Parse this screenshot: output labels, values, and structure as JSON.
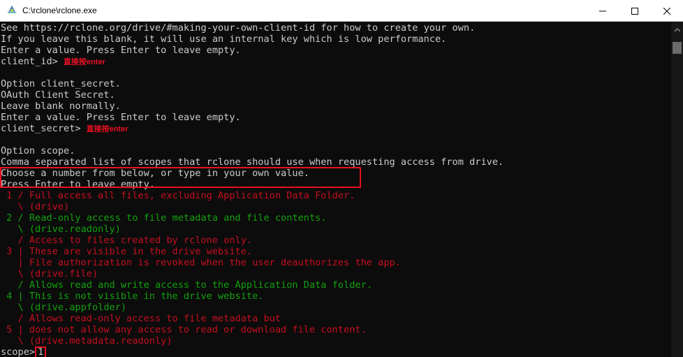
{
  "window": {
    "title": "C:\\rclone\\rclone.exe",
    "icons": {
      "app": "rclone-app-icon",
      "minimize": "minimize-icon",
      "maximize": "maximize-icon",
      "close": "close-icon"
    }
  },
  "console": {
    "lines": [
      {
        "text": "See https://rclone.org/drive/#making-your-own-client-id for how to create your own.",
        "color": "default"
      },
      {
        "text": "If you leave this blank, it will use an internal key which is low performance.",
        "color": "default"
      },
      {
        "text": "Enter a value. Press Enter to leave empty.",
        "color": "default"
      },
      {
        "text": "client_id>",
        "color": "default",
        "note": "直接按enter"
      },
      {
        "text": "",
        "color": "default"
      },
      {
        "text": "Option client_secret.",
        "color": "default"
      },
      {
        "text": "OAuth Client Secret.",
        "color": "default"
      },
      {
        "text": "Leave blank normally.",
        "color": "default"
      },
      {
        "text": "Enter a value. Press Enter to leave empty.",
        "color": "default"
      },
      {
        "text": "client_secret>",
        "color": "default",
        "note": "直接按enter"
      },
      {
        "text": "",
        "color": "default"
      },
      {
        "text": "Option scope.",
        "color": "default"
      },
      {
        "text": "Comma separated list of scopes that rclone should use when requesting access from drive.",
        "color": "default"
      },
      {
        "text": "Choose a number from below, or type in your own value.",
        "color": "default"
      },
      {
        "text": "Press Enter to leave empty.",
        "color": "default"
      },
      {
        "text": " 1 / Full access all files, excluding Application Data Folder.",
        "color": "red"
      },
      {
        "text": "   \\ (drive)",
        "color": "red"
      },
      {
        "text": " 2 / Read-only access to file metadata and file contents.",
        "color": "green"
      },
      {
        "text": "   \\ (drive.readonly)",
        "color": "green"
      },
      {
        "text": "   / Access to files created by rclone only.",
        "color": "red"
      },
      {
        "text": " 3 | These are visible in the drive website.",
        "color": "red"
      },
      {
        "text": "   | File authorization is revoked when the user deauthorizes the app.",
        "color": "red"
      },
      {
        "text": "   \\ (drive.file)",
        "color": "red"
      },
      {
        "text": "   / Allows read and write access to the Application Data folder.",
        "color": "green"
      },
      {
        "text": " 4 | This is not visible in the drive website.",
        "color": "green"
      },
      {
        "text": "   \\ (drive.appfolder)",
        "color": "green"
      },
      {
        "text": "   / Allows read-only access to file metadata but",
        "color": "red"
      },
      {
        "text": " 5 | does not allow any access to read or download file content.",
        "color": "red"
      },
      {
        "text": "   \\ (drive.metadata.readonly)",
        "color": "red"
      }
    ],
    "prompt": {
      "label": "scope>",
      "value": "1"
    }
  },
  "colors": {
    "background": "#0c0c0c",
    "default_text": "#cccccc",
    "green": "#13a10e",
    "red": "#c50f1f",
    "annotation": "#e81123"
  }
}
